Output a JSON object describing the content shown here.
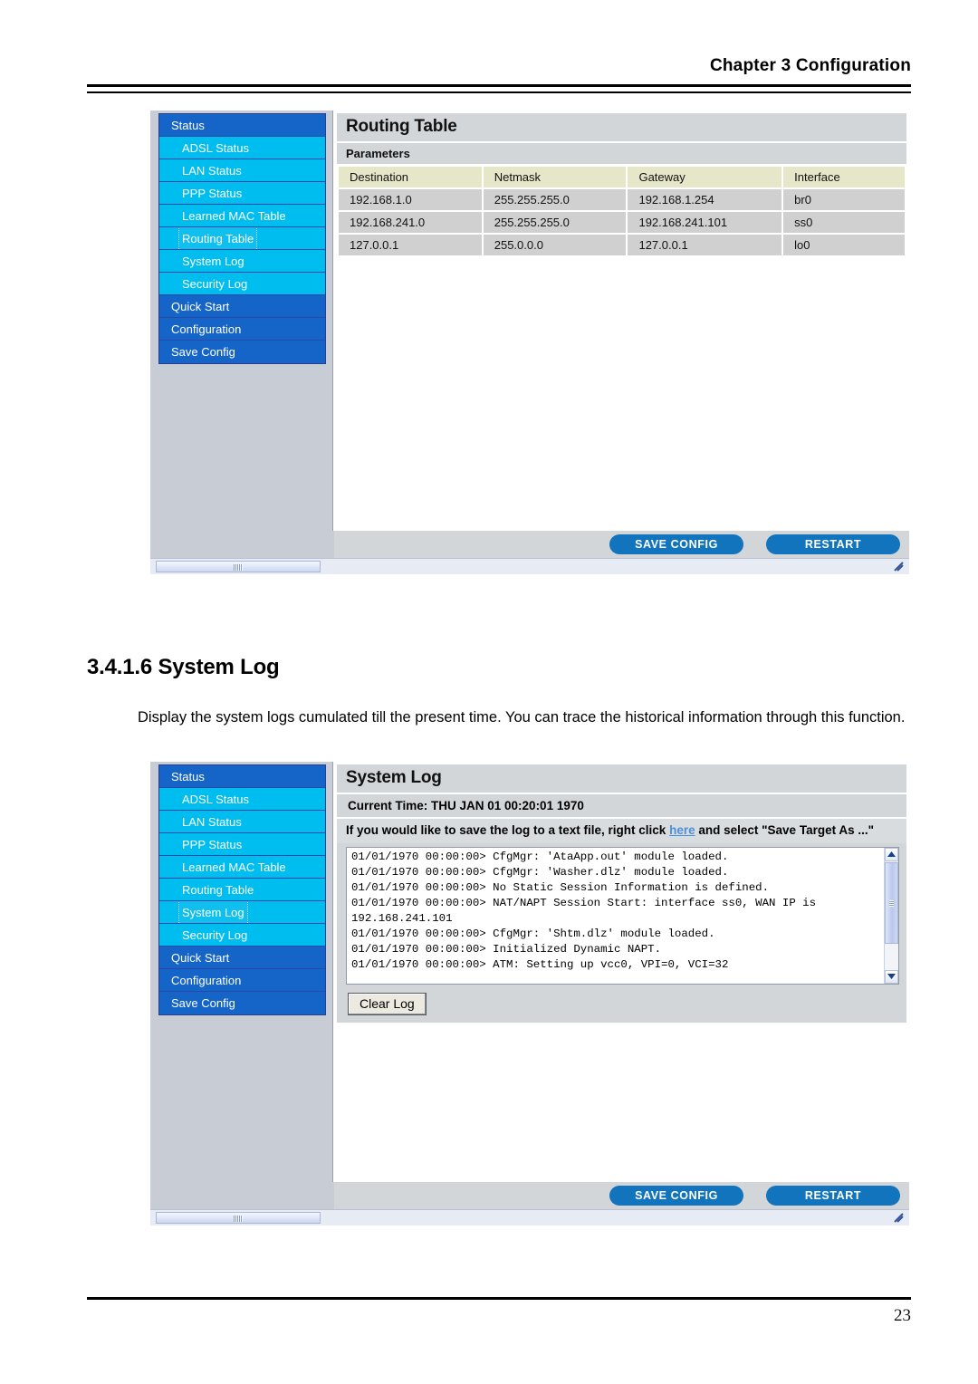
{
  "page": {
    "chapter_title": "Chapter 3 Configuration",
    "page_number": "23",
    "section_number_title": "3.4.1.6 System Log",
    "body_paragraph": "Display the system logs cumulated till the present time. You can trace the historical information through this function."
  },
  "sidebar_menu": [
    {
      "label": "Status",
      "level": 0
    },
    {
      "label": "ADSL Status",
      "level": 1
    },
    {
      "label": "LAN Status",
      "level": 1
    },
    {
      "label": "PPP Status",
      "level": 1
    },
    {
      "label": "Learned MAC Table",
      "level": 1
    },
    {
      "label": "Routing Table",
      "level": 1
    },
    {
      "label": "System Log",
      "level": 1
    },
    {
      "label": "Security Log",
      "level": 1
    },
    {
      "label": "Quick Start",
      "level": 0
    },
    {
      "label": "Configuration",
      "level": 0
    },
    {
      "label": "Save Config",
      "level": 0
    }
  ],
  "screenshot_routing": {
    "focused_menu_label": "Routing Table",
    "panel_title": "Routing Table",
    "panel_subtitle": "Parameters",
    "table": {
      "columns": [
        "Destination",
        "Netmask",
        "Gateway",
        "Interface"
      ],
      "rows": [
        [
          "192.168.1.0",
          "255.255.255.0",
          "192.168.1.254",
          "br0"
        ],
        [
          "192.168.241.0",
          "255.255.255.0",
          "192.168.241.101",
          "ss0"
        ],
        [
          "127.0.0.1",
          "255.0.0.0",
          "127.0.0.1",
          "lo0"
        ]
      ]
    },
    "footer": {
      "save_config_label": "SAVE CONFIG",
      "restart_label": "RESTART"
    }
  },
  "screenshot_systemlog": {
    "focused_menu_label": "System Log",
    "panel_title": "System Log",
    "current_time": "Current Time: THU JAN 01 00:20:01 1970",
    "note_prefix": "If you would like to save the log to a text file, right click ",
    "note_link": "here",
    "note_suffix": " and select \"Save Target As ...\"",
    "log_lines": [
      "01/01/1970 00:00:00> CfgMgr: 'AtaApp.out' module loaded.",
      "01/01/1970 00:00:00> CfgMgr: 'Washer.dlz' module loaded.",
      "01/01/1970 00:00:00> No Static Session Information is defined.",
      "01/01/1970 00:00:00> NAT/NAPT Session Start: interface ss0, WAN IP is 192.168.241.101",
      "01/01/1970 00:00:00> CfgMgr: 'Shtm.dlz' module loaded.",
      "01/01/1970 00:00:00> Initialized Dynamic NAPT.",
      "01/01/1970 00:00:00> ATM: Setting up vcc0, VPI=0, VCI=32"
    ],
    "clear_log_label": "Clear Log",
    "footer": {
      "save_config_label": "SAVE CONFIG",
      "restart_label": "RESTART"
    }
  },
  "colors": {
    "menu_level0": "#1565c8",
    "menu_level1": "#00bdef",
    "table_header": "#e6e6c8",
    "table_cell": "#d0d0d0",
    "panel_gray": "#d3d6d9",
    "button_blue": "#1274bd",
    "link_blue": "#4b90d8"
  }
}
